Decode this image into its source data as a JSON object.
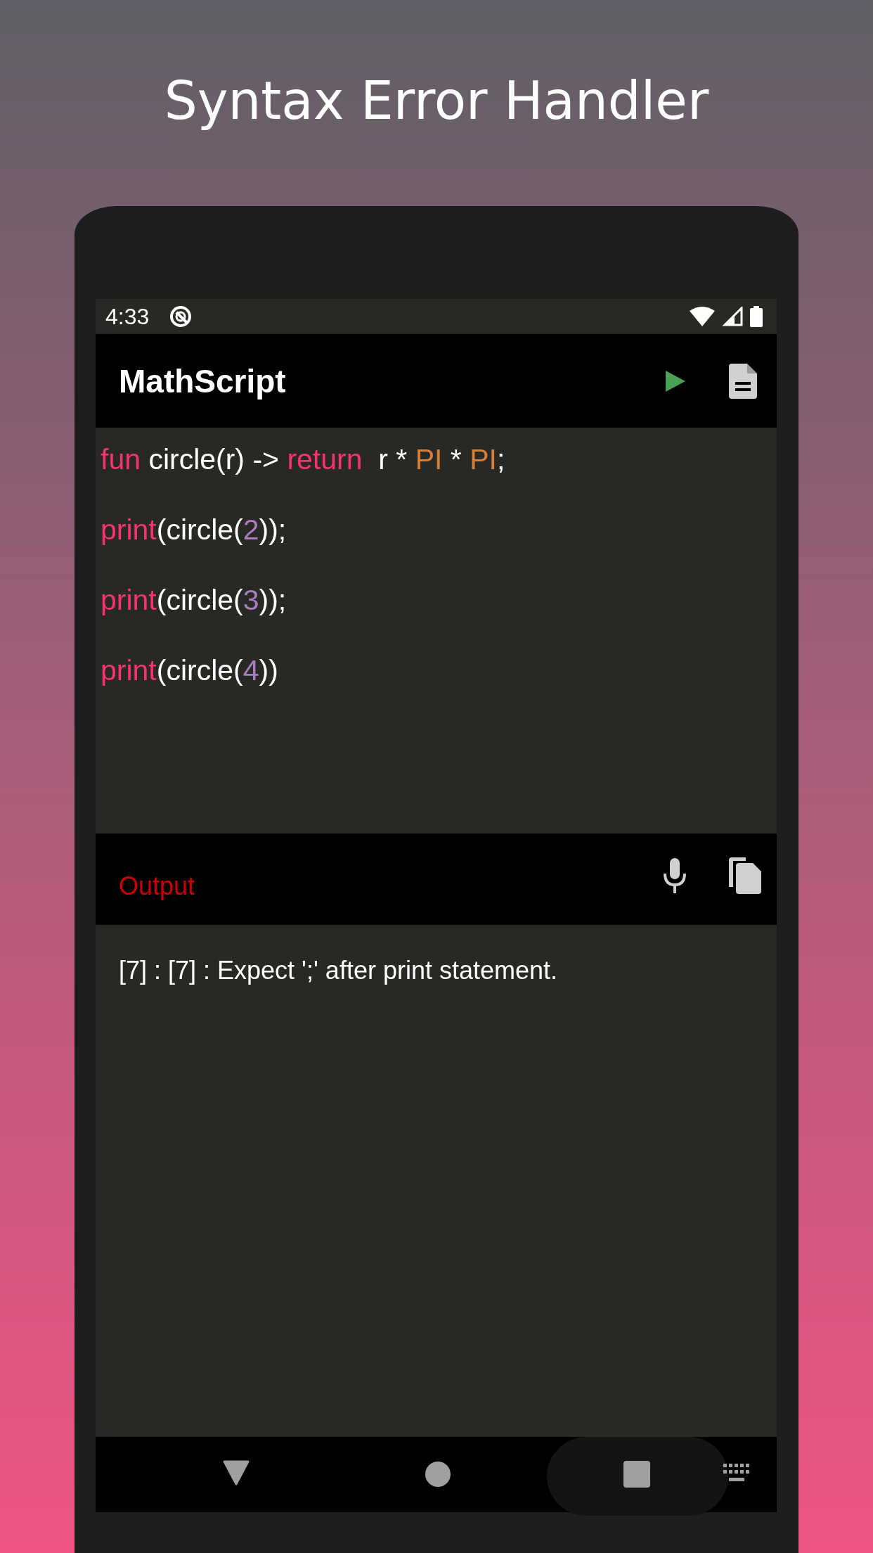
{
  "heading": "Syntax Error Handler",
  "status_bar": {
    "time": "4:33"
  },
  "toolbar": {
    "title": "MathScript"
  },
  "code": {
    "lines": [
      [
        {
          "kind": "keyword",
          "text": "fun"
        },
        {
          "kind": "plain",
          "text": " circle(r) -> "
        },
        {
          "kind": "keyword",
          "text": "return"
        },
        {
          "kind": "plain",
          "text": "  r * "
        },
        {
          "kind": "constant",
          "text": "PI"
        },
        {
          "kind": "plain",
          "text": " * "
        },
        {
          "kind": "constant",
          "text": "PI"
        },
        {
          "kind": "plain",
          "text": ";"
        }
      ],
      [
        {
          "kind": "keyword",
          "text": "print"
        },
        {
          "kind": "plain",
          "text": "(circle("
        },
        {
          "kind": "number",
          "text": "2"
        },
        {
          "kind": "plain",
          "text": "));"
        }
      ],
      [
        {
          "kind": "keyword",
          "text": "print"
        },
        {
          "kind": "plain",
          "text": "(circle("
        },
        {
          "kind": "number",
          "text": "3"
        },
        {
          "kind": "plain",
          "text": "));"
        }
      ],
      [
        {
          "kind": "keyword",
          "text": "print"
        },
        {
          "kind": "plain",
          "text": "(circle("
        },
        {
          "kind": "number",
          "text": "4"
        },
        {
          "kind": "plain",
          "text": "))"
        }
      ]
    ]
  },
  "output": {
    "title": "Output",
    "message": "[7] : [7] : Expect ';' after print statement."
  }
}
